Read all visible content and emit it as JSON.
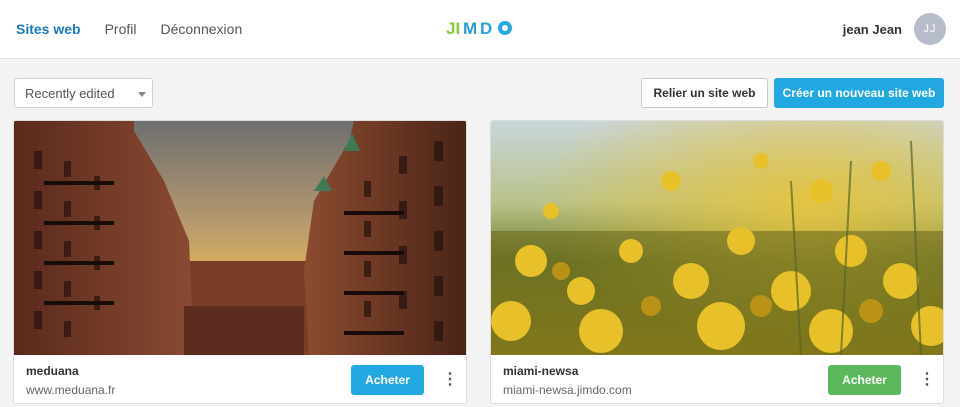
{
  "nav": {
    "items": [
      {
        "label": "Sites web",
        "active": true
      },
      {
        "label": "Profil",
        "active": false
      },
      {
        "label": "Déconnexion",
        "active": false
      }
    ]
  },
  "logo": {
    "text": "JIMDO",
    "colors": [
      "#8ac640",
      "#21a8e0"
    ]
  },
  "user": {
    "name": "jean Jean",
    "initials": "JJ"
  },
  "toolbar": {
    "sort_value": "Recently edited",
    "link_label": "Relier un site web",
    "create_label": "Créer un nouveau site web"
  },
  "sites": [
    {
      "name": "meduana",
      "url": "www.meduana.fr",
      "buy_label": "Acheter",
      "buy_color": "#21a8e0",
      "image": "red-brick-warehouse-canal-sunset"
    },
    {
      "name": "miami-newsa",
      "url": "miami-newsa.jimdo.com",
      "buy_label": "Acheter",
      "buy_color": "#5cb85c",
      "image": "yellow-rapeseed-flowers-field"
    }
  ],
  "colors": {
    "accent": "#21a8e0",
    "success": "#5cb85c",
    "nav_active": "#1a7bbf"
  }
}
